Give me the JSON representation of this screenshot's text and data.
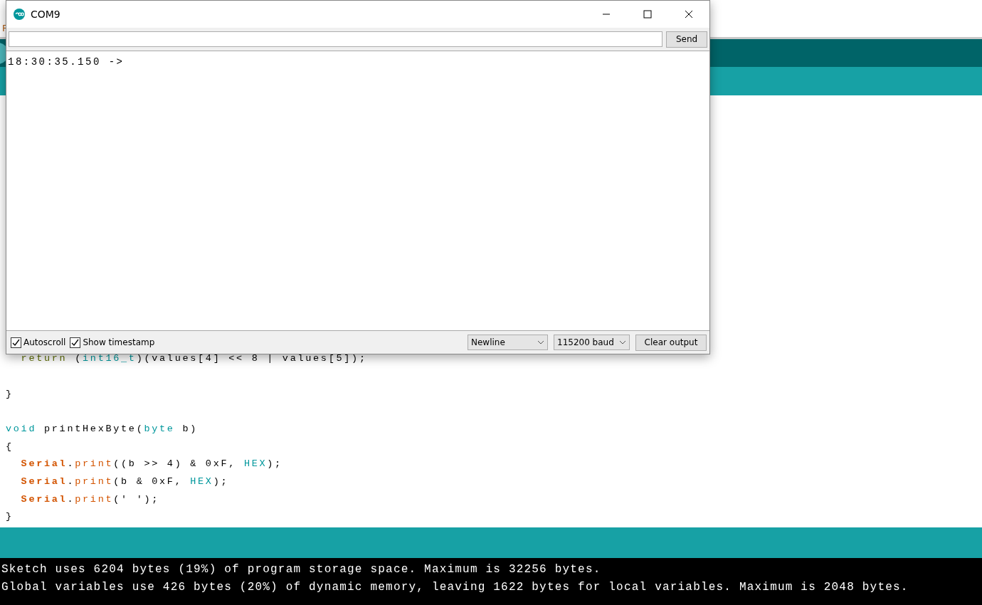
{
  "ide": {
    "menu_fragment": "F",
    "code_lines": [
      [
        {
          "text": "  return",
          "kind": "keyword2"
        },
        {
          "text": " ("
        },
        {
          "text": "int16_t",
          "kind": "type"
        },
        {
          "text": ")(values[4] << 8 | values[5]);"
        }
      ],
      {
        "blank_before": true,
        "tokens": [
          {
            "text": "}"
          }
        ]
      },
      {
        "blank_before": true,
        "tokens": [
          {
            "text": "void",
            "kind": "type"
          },
          {
            "text": " printHexByte("
          },
          {
            "text": "byte",
            "kind": "type"
          },
          {
            "text": " b)"
          }
        ]
      },
      [
        {
          "text": "{"
        }
      ],
      [
        {
          "text": "  Serial",
          "kind": "class"
        },
        {
          "text": "."
        },
        {
          "text": "print",
          "kind": "method"
        },
        {
          "text": "((b >> 4) & 0xF, "
        },
        {
          "text": "HEX",
          "kind": "const"
        },
        {
          "text": ");"
        }
      ],
      [
        {
          "text": "  Serial",
          "kind": "class"
        },
        {
          "text": "."
        },
        {
          "text": "print",
          "kind": "method"
        },
        {
          "text": "(b & 0xF, "
        },
        {
          "text": "HEX",
          "kind": "const"
        },
        {
          "text": ");"
        }
      ],
      [
        {
          "text": "  Serial",
          "kind": "class"
        },
        {
          "text": "."
        },
        {
          "text": "print",
          "kind": "method"
        },
        {
          "text": "(' ');"
        }
      ],
      [
        {
          "text": "}"
        }
      ]
    ],
    "console_lines": [
      "Sketch uses 6204 bytes (19%) of program storage space. Maximum is 32256 bytes.",
      "Global variables use 426 bytes (20%) of dynamic memory, leaving 1622 bytes for local variables. Maximum is 2048 bytes."
    ]
  },
  "serial_monitor": {
    "title": "COM9",
    "send_button": "Send",
    "output_lines": [
      "18:30:35.150 ->"
    ],
    "options": [
      {
        "label": "Autoscroll",
        "checked": true
      },
      {
        "label": "Show timestamp",
        "checked": true
      }
    ],
    "line_ending": "Newline",
    "baud": "115200 baud",
    "clear_button": "Clear output"
  }
}
